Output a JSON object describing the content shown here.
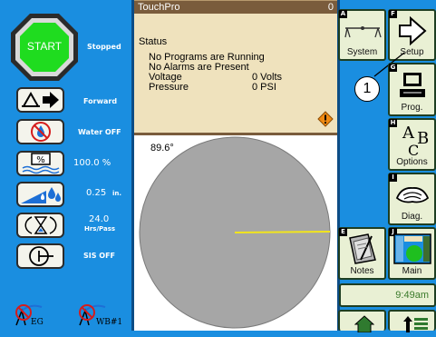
{
  "left_panel": {
    "start_label": "START",
    "pivot_status": "Stopped",
    "direction": "Forward",
    "water": "Water OFF",
    "percent_timer": "100.0 %",
    "application_depth": "0.25",
    "depth_unit": "in.",
    "hours_per_pass": "24.0",
    "hours_per_pass_unit": "Hrs/Pass",
    "sis_status": "SIS OFF",
    "eg_label": "EG",
    "wb_label": "WB#1"
  },
  "title_bar": {
    "title": "TouchPro",
    "number": "0"
  },
  "status_panel": {
    "heading": "Status",
    "line1": "No Programs are Running",
    "line2": "No Alarms are Present",
    "voltage_label": "Voltage",
    "voltage_value": "0 Volts",
    "pressure_label": "Pressure",
    "pressure_value": "0 PSI"
  },
  "pivot_map": {
    "angle": "89.6°"
  },
  "right_panel": {
    "system": {
      "letter": "A",
      "label": "System"
    },
    "setup": {
      "letter": "F",
      "label": "Setup"
    },
    "callout": "1",
    "prog": {
      "letter": "G",
      "label": "Prog."
    },
    "options": {
      "letter": "H",
      "label": "Options",
      "glyph_a": "A",
      "glyph_b": "B",
      "glyph_c": "C"
    },
    "diag": {
      "letter": "I",
      "label": "Diag."
    },
    "notes": {
      "letter": "E",
      "label": "Notes"
    },
    "main": {
      "letter": "J",
      "label": "Main"
    },
    "clock": "9:49am"
  },
  "colors": {
    "background": "#1a8ee0",
    "start_green": "#1fdc1f",
    "title_bar": "#7a5c3c",
    "status_bg": "#efe2bd",
    "pivot_gray": "#a6a6a6",
    "pivot_arm": "#f2e51c",
    "warning": "#f08a12"
  }
}
